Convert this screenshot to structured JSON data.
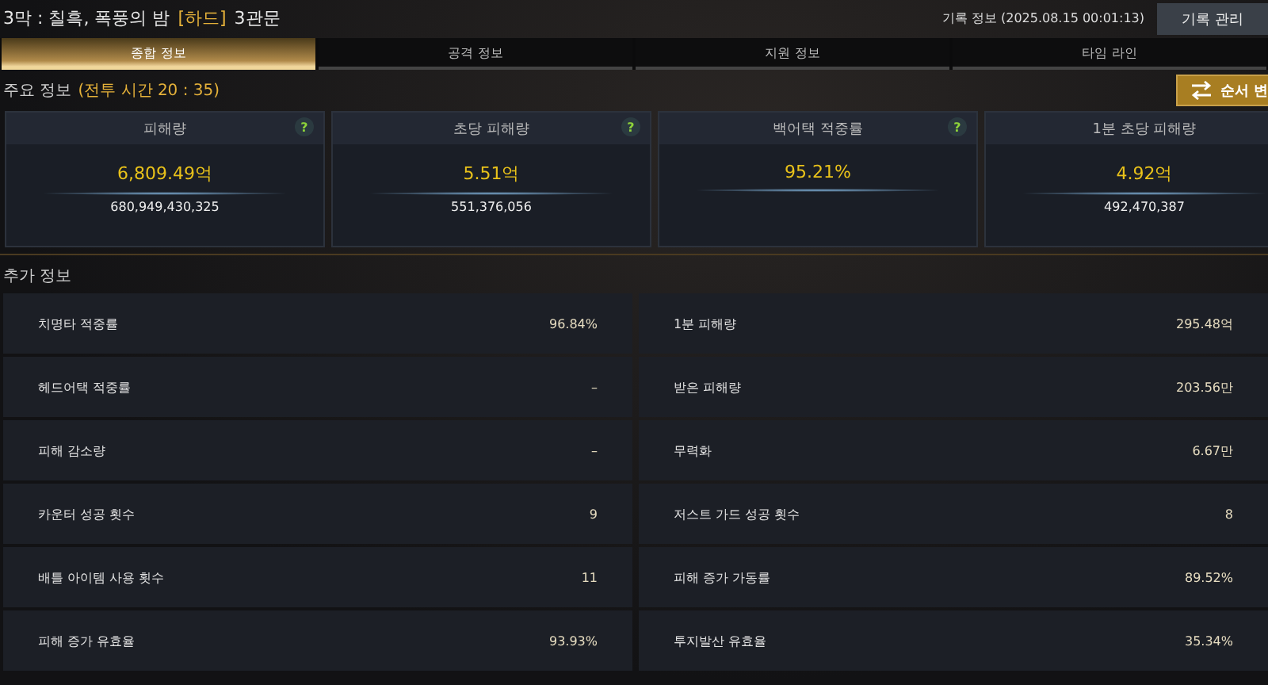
{
  "header": {
    "title_prefix": "3막 : 칠흑, 폭풍의 밤",
    "difficulty": "[하드]",
    "stage": "3관문",
    "record_info": "기록 정보 (2025.08.15 00:01:13)",
    "manage_button": "기록 관리"
  },
  "tabs": [
    {
      "label": "종합 정보",
      "selected": true
    },
    {
      "label": "공격 정보",
      "selected": false
    },
    {
      "label": "지원 정보",
      "selected": false
    },
    {
      "label": "타임 라인",
      "selected": false
    }
  ],
  "main_info": {
    "label": "주요 정보",
    "battle_time": "(전투 시간 20 : 35)",
    "order_button": "순서 변"
  },
  "cards": [
    {
      "title": "피해량",
      "value": "6,809.49억",
      "detail": "680,949,430,325",
      "help": "?"
    },
    {
      "title": "초당 피해량",
      "value": "5.51억",
      "detail": "551,376,056",
      "help": "?"
    },
    {
      "title": "백어택 적중률",
      "value": "95.21%",
      "help": "?"
    },
    {
      "title": "1분 초당 피해량",
      "value": "4.92억",
      "detail": "492,470,387"
    }
  ],
  "extra_info": {
    "label": "추가 정보"
  },
  "stats": [
    {
      "label": "치명타 적중률",
      "value": "96.84%"
    },
    {
      "label": "1분 피해량",
      "value": "295.48억"
    },
    {
      "label": "헤드어택 적중률",
      "value": "–"
    },
    {
      "label": "받은 피해량",
      "value": "203.56만"
    },
    {
      "label": "피해 감소량",
      "value": "–"
    },
    {
      "label": "무력화",
      "value": "6.67만"
    },
    {
      "label": "카운터 성공 횟수",
      "value": "9"
    },
    {
      "label": "저스트 가드 성공 횟수",
      "value": "8"
    },
    {
      "label": "배틀 아이템 사용 횟수",
      "value": "11"
    },
    {
      "label": "피해 증가 가동률",
      "value": "89.52%"
    },
    {
      "label": "피해 증가 유효율",
      "value": "93.93%"
    },
    {
      "label": "투지발산 유효율",
      "value": "35.34%"
    }
  ]
}
